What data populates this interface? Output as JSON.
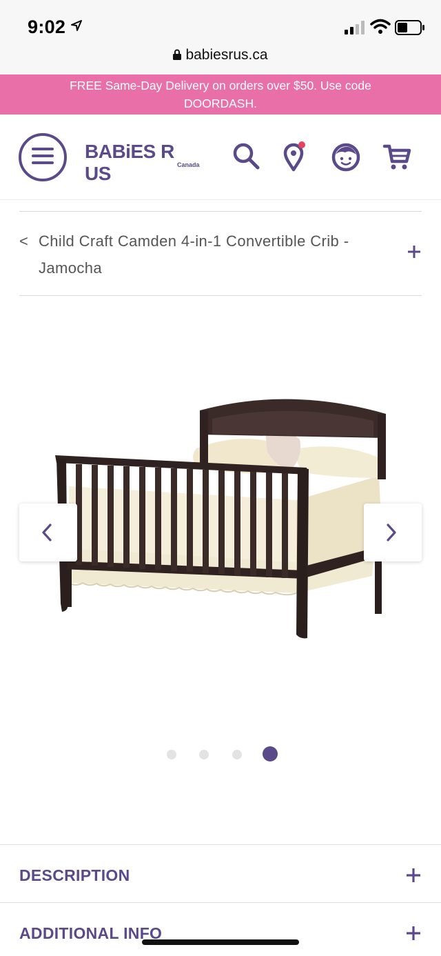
{
  "status_bar": {
    "time": "9:02"
  },
  "browser": {
    "url": "babiesrus.ca"
  },
  "promo": {
    "text": "FREE Same-Day Delivery on orders over $50. Use code DOORDASH."
  },
  "header": {
    "logo_text": "BABiES R US",
    "logo_sub": "Canada",
    "icons": [
      "menu-icon",
      "search-icon",
      "store-locator-icon",
      "account-icon",
      "cart-icon"
    ]
  },
  "breadcrumb": {
    "back": "<",
    "title": "Child Craft Camden 4-in-1 Convertible Crib - Jamocha"
  },
  "carousel": {
    "total_images": 4,
    "active_index": 4,
    "prev_icon": "chevron-left-icon",
    "next_icon": "chevron-right-icon"
  },
  "accordion": [
    {
      "label": "DESCRIPTION"
    },
    {
      "label": "ADDITIONAL INFO"
    }
  ],
  "colors": {
    "brand": "#5a4a8a",
    "promo_bg": "#e96fa9"
  }
}
